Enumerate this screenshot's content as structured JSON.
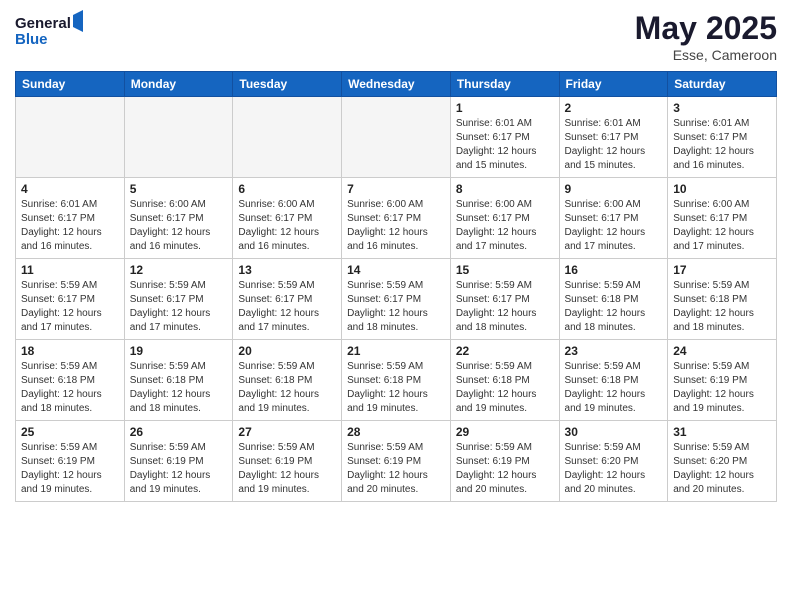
{
  "header": {
    "logo_line1": "General",
    "logo_line2": "Blue",
    "month_year": "May 2025",
    "location": "Esse, Cameroon"
  },
  "weekdays": [
    "Sunday",
    "Monday",
    "Tuesday",
    "Wednesday",
    "Thursday",
    "Friday",
    "Saturday"
  ],
  "weeks": [
    [
      {
        "day": "",
        "info": ""
      },
      {
        "day": "",
        "info": ""
      },
      {
        "day": "",
        "info": ""
      },
      {
        "day": "",
        "info": ""
      },
      {
        "day": "1",
        "info": "Sunrise: 6:01 AM\nSunset: 6:17 PM\nDaylight: 12 hours\nand 15 minutes."
      },
      {
        "day": "2",
        "info": "Sunrise: 6:01 AM\nSunset: 6:17 PM\nDaylight: 12 hours\nand 15 minutes."
      },
      {
        "day": "3",
        "info": "Sunrise: 6:01 AM\nSunset: 6:17 PM\nDaylight: 12 hours\nand 16 minutes."
      }
    ],
    [
      {
        "day": "4",
        "info": "Sunrise: 6:01 AM\nSunset: 6:17 PM\nDaylight: 12 hours\nand 16 minutes."
      },
      {
        "day": "5",
        "info": "Sunrise: 6:00 AM\nSunset: 6:17 PM\nDaylight: 12 hours\nand 16 minutes."
      },
      {
        "day": "6",
        "info": "Sunrise: 6:00 AM\nSunset: 6:17 PM\nDaylight: 12 hours\nand 16 minutes."
      },
      {
        "day": "7",
        "info": "Sunrise: 6:00 AM\nSunset: 6:17 PM\nDaylight: 12 hours\nand 16 minutes."
      },
      {
        "day": "8",
        "info": "Sunrise: 6:00 AM\nSunset: 6:17 PM\nDaylight: 12 hours\nand 17 minutes."
      },
      {
        "day": "9",
        "info": "Sunrise: 6:00 AM\nSunset: 6:17 PM\nDaylight: 12 hours\nand 17 minutes."
      },
      {
        "day": "10",
        "info": "Sunrise: 6:00 AM\nSunset: 6:17 PM\nDaylight: 12 hours\nand 17 minutes."
      }
    ],
    [
      {
        "day": "11",
        "info": "Sunrise: 5:59 AM\nSunset: 6:17 PM\nDaylight: 12 hours\nand 17 minutes."
      },
      {
        "day": "12",
        "info": "Sunrise: 5:59 AM\nSunset: 6:17 PM\nDaylight: 12 hours\nand 17 minutes."
      },
      {
        "day": "13",
        "info": "Sunrise: 5:59 AM\nSunset: 6:17 PM\nDaylight: 12 hours\nand 17 minutes."
      },
      {
        "day": "14",
        "info": "Sunrise: 5:59 AM\nSunset: 6:17 PM\nDaylight: 12 hours\nand 18 minutes."
      },
      {
        "day": "15",
        "info": "Sunrise: 5:59 AM\nSunset: 6:17 PM\nDaylight: 12 hours\nand 18 minutes."
      },
      {
        "day": "16",
        "info": "Sunrise: 5:59 AM\nSunset: 6:18 PM\nDaylight: 12 hours\nand 18 minutes."
      },
      {
        "day": "17",
        "info": "Sunrise: 5:59 AM\nSunset: 6:18 PM\nDaylight: 12 hours\nand 18 minutes."
      }
    ],
    [
      {
        "day": "18",
        "info": "Sunrise: 5:59 AM\nSunset: 6:18 PM\nDaylight: 12 hours\nand 18 minutes."
      },
      {
        "day": "19",
        "info": "Sunrise: 5:59 AM\nSunset: 6:18 PM\nDaylight: 12 hours\nand 18 minutes."
      },
      {
        "day": "20",
        "info": "Sunrise: 5:59 AM\nSunset: 6:18 PM\nDaylight: 12 hours\nand 19 minutes."
      },
      {
        "day": "21",
        "info": "Sunrise: 5:59 AM\nSunset: 6:18 PM\nDaylight: 12 hours\nand 19 minutes."
      },
      {
        "day": "22",
        "info": "Sunrise: 5:59 AM\nSunset: 6:18 PM\nDaylight: 12 hours\nand 19 minutes."
      },
      {
        "day": "23",
        "info": "Sunrise: 5:59 AM\nSunset: 6:18 PM\nDaylight: 12 hours\nand 19 minutes."
      },
      {
        "day": "24",
        "info": "Sunrise: 5:59 AM\nSunset: 6:19 PM\nDaylight: 12 hours\nand 19 minutes."
      }
    ],
    [
      {
        "day": "25",
        "info": "Sunrise: 5:59 AM\nSunset: 6:19 PM\nDaylight: 12 hours\nand 19 minutes."
      },
      {
        "day": "26",
        "info": "Sunrise: 5:59 AM\nSunset: 6:19 PM\nDaylight: 12 hours\nand 19 minutes."
      },
      {
        "day": "27",
        "info": "Sunrise: 5:59 AM\nSunset: 6:19 PM\nDaylight: 12 hours\nand 19 minutes."
      },
      {
        "day": "28",
        "info": "Sunrise: 5:59 AM\nSunset: 6:19 PM\nDaylight: 12 hours\nand 20 minutes."
      },
      {
        "day": "29",
        "info": "Sunrise: 5:59 AM\nSunset: 6:19 PM\nDaylight: 12 hours\nand 20 minutes."
      },
      {
        "day": "30",
        "info": "Sunrise: 5:59 AM\nSunset: 6:20 PM\nDaylight: 12 hours\nand 20 minutes."
      },
      {
        "day": "31",
        "info": "Sunrise: 5:59 AM\nSunset: 6:20 PM\nDaylight: 12 hours\nand 20 minutes."
      }
    ]
  ]
}
